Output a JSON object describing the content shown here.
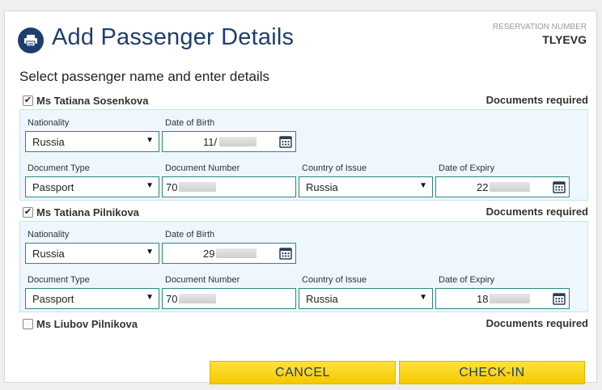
{
  "dialog": {
    "title": "Add Passenger Details",
    "reservation_label": "RESERVATION NUMBER",
    "reservation_number": "TLYEVG",
    "subtitle": "Select passenger name and enter details",
    "title_icon": "printer-icon"
  },
  "labels": {
    "nationality": "Nationality",
    "date_of_birth": "Date of Birth",
    "document_type": "Document Type",
    "document_number": "Document Number",
    "country_of_issue": "Country of Issue",
    "date_of_expiry": "Date of Expiry"
  },
  "passengers": [
    {
      "name": "Ms Tatiana Sosenkova",
      "checked": true,
      "status": "Documents required",
      "nationality": "Russia",
      "date_of_birth": "11/",
      "document_type": "Passport",
      "document_number": "70",
      "country_of_issue": "Russia",
      "date_of_expiry": "22"
    },
    {
      "name": "Ms Tatiana Pilnikova",
      "checked": true,
      "status": "Documents required",
      "nationality": "Russia",
      "date_of_birth": "29",
      "document_type": "Passport",
      "document_number": "70",
      "country_of_issue": "Russia",
      "date_of_expiry": "18"
    },
    {
      "name": "Ms Liubov Pilnikova",
      "checked": false,
      "status": "Documents required"
    }
  ],
  "checkbox_checked_glyph": "✔",
  "buttons": {
    "cancel": "CANCEL",
    "checkin": "CHECK-IN"
  },
  "colors": {
    "brand_blue": "#1f3e6e",
    "button_yellow": "#ffd200",
    "field_border": "#2a8a80"
  }
}
